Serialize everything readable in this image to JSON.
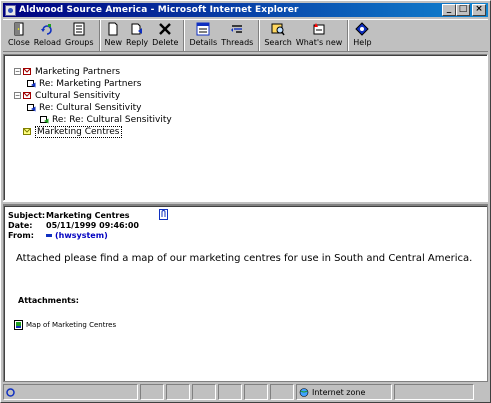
{
  "window": {
    "title": "Aldwood Source America - Microsoft Internet Explorer",
    "controls": {
      "minimize": "_",
      "maximize": "□",
      "close": "×"
    }
  },
  "toolbar": {
    "groups": [
      [
        {
          "label": "Close",
          "icon": "close-door-icon"
        },
        {
          "label": "Reload",
          "icon": "reload-icon"
        },
        {
          "label": "Groups",
          "icon": "groups-icon"
        }
      ],
      [
        {
          "label": "New",
          "icon": "new-document-icon"
        },
        {
          "label": "Reply",
          "icon": "reply-icon"
        },
        {
          "label": "Delete",
          "icon": "delete-x-icon"
        }
      ],
      [
        {
          "label": "Details",
          "icon": "details-icon"
        },
        {
          "label": "Threads",
          "icon": "threads-icon"
        }
      ],
      [
        {
          "label": "Search",
          "icon": "search-icon"
        },
        {
          "label": "What's new",
          "icon": "whats-new-icon"
        }
      ],
      [
        {
          "label": "Help",
          "icon": "help-icon"
        }
      ]
    ]
  },
  "tree": {
    "items": [
      {
        "label": "Marketing Partners",
        "expander": "−",
        "icon": "thread-open-icon"
      },
      {
        "label": "Re: Marketing Partners",
        "expander": "",
        "icon": "reply-message-icon"
      },
      {
        "label": "Cultural Sensitivity",
        "expander": "−",
        "icon": "thread-open-icon"
      },
      {
        "label": "Re: Cultural Sensitivity",
        "expander": "",
        "icon": "reply-message-icon"
      },
      {
        "label": "Re: Re: Cultural Sensitivity",
        "expander": "",
        "icon": "reply-reply-message-icon"
      },
      {
        "label": "Marketing Centres",
        "expander": "",
        "icon": "message-attachment-icon"
      }
    ]
  },
  "message": {
    "subject_label": "Subject:",
    "subject": "Marketing Centres",
    "date_label": "Date:",
    "date": "05/11/1999 09:46:00",
    "from_label": "From:",
    "from": "(hwsystem)",
    "body": "Attached please find a map of our marketing centres for use in South and Central America.",
    "attachments_title": "Attachments:",
    "attachment": "Map of Marketing Centres"
  },
  "status": {
    "zone": "Internet zone"
  },
  "colors": {
    "titlebar_start": "#000080",
    "titlebar_end": "#1084d0",
    "link": "#0000c0",
    "chrome": "#c0c0c0"
  }
}
